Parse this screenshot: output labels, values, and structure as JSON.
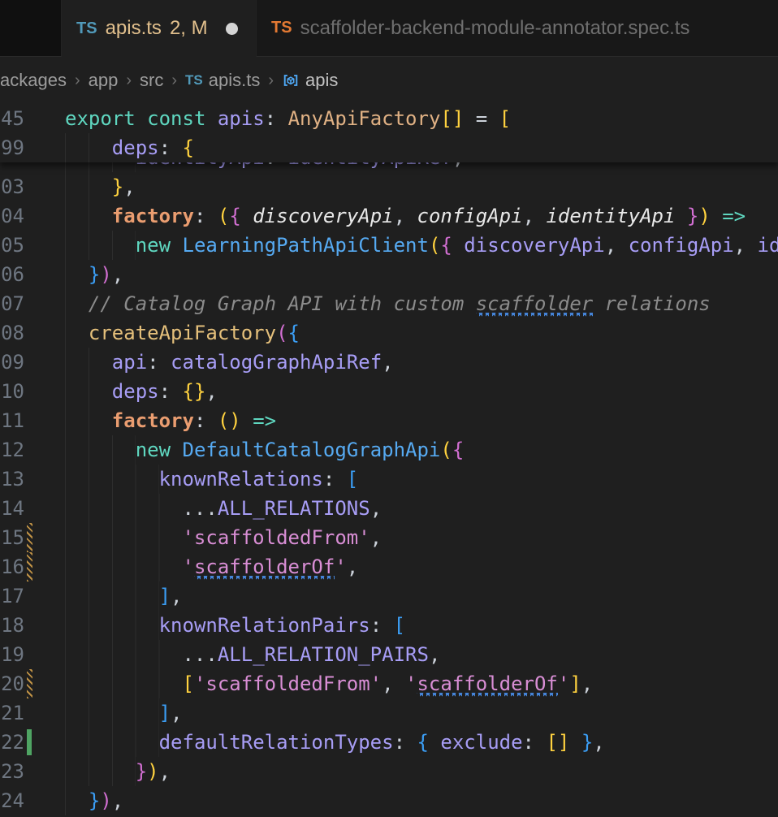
{
  "colors": {
    "editor_bg": "#1f1f1f",
    "tabstrip_bg": "#181818",
    "active_tab_bg": "#1f1f1f",
    "modified_gold": "#e2c08d",
    "ts_icon_blue": "#519aba",
    "ts_icon_orange": "#e37933",
    "inactive_tab_text": "#6f6f6f",
    "breadcrumb_text": "#9d9d9d",
    "line_number": "#6e7681",
    "squiggle_blue": "#4584d8",
    "gutter_modified": "#c09245",
    "gutter_added": "#4fa463",
    "keyword": "#5fd7c0",
    "var": "#a79df5",
    "prop": "#a79df5",
    "type": "#e0b184",
    "func": "#e5c07b",
    "member": "#ea9d70",
    "string": "#d98ed5",
    "class": "#56aaf2",
    "comment": "#8b8b8b",
    "param": "#e8e8e8",
    "punct": "#ccd2da",
    "b1": "#ffd23f",
    "b2": "#d26fd2",
    "b3": "#3b9ef5"
  },
  "tabs": [
    {
      "icon": "TS",
      "label": "apis.ts",
      "badge": "2, M",
      "modified_dot": true,
      "active": true
    },
    {
      "icon": "TS",
      "label": "scaffolder-backend-module-annotator.spec.ts",
      "badge": "",
      "modified_dot": false,
      "active": false
    }
  ],
  "breadcrumb": {
    "items": [
      "ackages",
      "app",
      "src",
      "apis.ts",
      "apis"
    ],
    "separator": "›",
    "file_icon": "TS"
  },
  "editor": {
    "sticky_lines": [
      {
        "num": "45",
        "ind": 0,
        "tokens": [
          {
            "t": "export",
            "c": "keyword"
          },
          {
            "t": " ",
            "c": "punct"
          },
          {
            "t": "const",
            "c": "keyword"
          },
          {
            "t": " ",
            "c": "punct"
          },
          {
            "t": "apis",
            "c": "var"
          },
          {
            "t": ": ",
            "c": "punct"
          },
          {
            "t": "AnyApiFactory",
            "c": "type"
          },
          {
            "t": "[]",
            "c": "b1"
          },
          {
            "t": " = ",
            "c": "punct"
          },
          {
            "t": "[",
            "c": "b1"
          }
        ]
      },
      {
        "num": "99",
        "ind": 4,
        "tokens": [
          {
            "t": "deps",
            "c": "prop"
          },
          {
            "t": ": ",
            "c": "punct"
          },
          {
            "t": "{",
            "c": "b1"
          }
        ]
      }
    ],
    "lines": [
      {
        "num": "",
        "ind": 6,
        "tokens": [
          {
            "t": "identityApi",
            "c": "prop"
          },
          {
            "t": ": ",
            "c": "punct"
          },
          {
            "t": "identityApiRef",
            "c": "var"
          },
          {
            "t": ",",
            "c": "punct"
          }
        ]
      },
      {
        "num": "03",
        "ind": 4,
        "tokens": [
          {
            "t": "}",
            "c": "b1"
          },
          {
            "t": ",",
            "c": "punct"
          }
        ]
      },
      {
        "num": "04",
        "ind": 4,
        "tokens": [
          {
            "t": "factory",
            "c": "member",
            "b": 1
          },
          {
            "t": ": ",
            "c": "punct"
          },
          {
            "t": "(",
            "c": "b1"
          },
          {
            "t": "{",
            "c": "b2"
          },
          {
            "t": " ",
            "c": "punct"
          },
          {
            "t": "discoveryApi",
            "c": "param",
            "i": 1
          },
          {
            "t": ", ",
            "c": "punct"
          },
          {
            "t": "configApi",
            "c": "param",
            "i": 1
          },
          {
            "t": ", ",
            "c": "punct"
          },
          {
            "t": "identityApi",
            "c": "param",
            "i": 1
          },
          {
            "t": " ",
            "c": "punct"
          },
          {
            "t": "}",
            "c": "b2"
          },
          {
            "t": ")",
            "c": "b1"
          },
          {
            "t": " ",
            "c": "punct"
          },
          {
            "t": "=>",
            "c": "keyword"
          }
        ]
      },
      {
        "num": "05",
        "ind": 6,
        "tokens": [
          {
            "t": "new",
            "c": "keyword"
          },
          {
            "t": " ",
            "c": "punct"
          },
          {
            "t": "LearningPathApiClient",
            "c": "class"
          },
          {
            "t": "(",
            "c": "b1"
          },
          {
            "t": "{",
            "c": "b2"
          },
          {
            "t": " ",
            "c": "punct"
          },
          {
            "t": "discoveryApi",
            "c": "var"
          },
          {
            "t": ", ",
            "c": "punct"
          },
          {
            "t": "configApi",
            "c": "var"
          },
          {
            "t": ", ",
            "c": "punct"
          },
          {
            "t": "id",
            "c": "var"
          }
        ]
      },
      {
        "num": "06",
        "ind": 2,
        "tokens": [
          {
            "t": "}",
            "c": "b3"
          },
          {
            "t": ")",
            "c": "b2"
          },
          {
            "t": ",",
            "c": "punct"
          }
        ]
      },
      {
        "num": "07",
        "ind": 2,
        "tokens": [
          {
            "t": "// Catalog Graph API with custom ",
            "c": "comment",
            "i": 1
          },
          {
            "t": "scaffolder",
            "c": "comment",
            "i": 1,
            "sq": 1
          },
          {
            "t": " relations",
            "c": "comment",
            "i": 1
          }
        ]
      },
      {
        "num": "08",
        "ind": 2,
        "tokens": [
          {
            "t": "createApiFactory",
            "c": "func"
          },
          {
            "t": "(",
            "c": "b2"
          },
          {
            "t": "{",
            "c": "b3"
          }
        ]
      },
      {
        "num": "09",
        "ind": 4,
        "tokens": [
          {
            "t": "api",
            "c": "prop"
          },
          {
            "t": ": ",
            "c": "punct"
          },
          {
            "t": "catalogGraphApiRef",
            "c": "var"
          },
          {
            "t": ",",
            "c": "punct"
          }
        ]
      },
      {
        "num": "10",
        "ind": 4,
        "tokens": [
          {
            "t": "deps",
            "c": "prop"
          },
          {
            "t": ": ",
            "c": "punct"
          },
          {
            "t": "{}",
            "c": "b1"
          },
          {
            "t": ",",
            "c": "punct"
          }
        ]
      },
      {
        "num": "11",
        "ind": 4,
        "tokens": [
          {
            "t": "factory",
            "c": "member",
            "b": 1
          },
          {
            "t": ": ",
            "c": "punct"
          },
          {
            "t": "()",
            "c": "b1"
          },
          {
            "t": " ",
            "c": "punct"
          },
          {
            "t": "=>",
            "c": "keyword"
          }
        ]
      },
      {
        "num": "12",
        "ind": 6,
        "tokens": [
          {
            "t": "new",
            "c": "keyword"
          },
          {
            "t": " ",
            "c": "punct"
          },
          {
            "t": "DefaultCatalogGraphApi",
            "c": "class"
          },
          {
            "t": "(",
            "c": "b1"
          },
          {
            "t": "{",
            "c": "b2"
          }
        ]
      },
      {
        "num": "13",
        "ind": 8,
        "tokens": [
          {
            "t": "knownRelations",
            "c": "prop"
          },
          {
            "t": ": ",
            "c": "punct"
          },
          {
            "t": "[",
            "c": "b3"
          }
        ]
      },
      {
        "num": "14",
        "ind": 10,
        "tokens": [
          {
            "t": "...",
            "c": "punct"
          },
          {
            "t": "ALL_RELATIONS",
            "c": "var"
          },
          {
            "t": ",",
            "c": "punct"
          }
        ]
      },
      {
        "num": "15",
        "ind": 10,
        "marker": "modified",
        "tokens": [
          {
            "t": "'scaffoldedFrom'",
            "c": "string"
          },
          {
            "t": ",",
            "c": "punct"
          }
        ]
      },
      {
        "num": "16",
        "ind": 10,
        "marker": "modified",
        "tokens": [
          {
            "t": "'",
            "c": "string"
          },
          {
            "t": "scaffolderOf",
            "c": "string",
            "sq": 1
          },
          {
            "t": "'",
            "c": "string"
          },
          {
            "t": ",",
            "c": "punct"
          }
        ]
      },
      {
        "num": "17",
        "ind": 8,
        "tokens": [
          {
            "t": "]",
            "c": "b3"
          },
          {
            "t": ",",
            "c": "punct"
          }
        ]
      },
      {
        "num": "18",
        "ind": 8,
        "tokens": [
          {
            "t": "knownRelationPairs",
            "c": "prop"
          },
          {
            "t": ": ",
            "c": "punct"
          },
          {
            "t": "[",
            "c": "b3"
          }
        ]
      },
      {
        "num": "19",
        "ind": 10,
        "tokens": [
          {
            "t": "...",
            "c": "punct"
          },
          {
            "t": "ALL_RELATION_PAIRS",
            "c": "var"
          },
          {
            "t": ",",
            "c": "punct"
          }
        ]
      },
      {
        "num": "20",
        "ind": 10,
        "marker": "modified",
        "tokens": [
          {
            "t": "[",
            "c": "b1"
          },
          {
            "t": "'scaffoldedFrom'",
            "c": "string"
          },
          {
            "t": ", ",
            "c": "punct"
          },
          {
            "t": "'",
            "c": "string"
          },
          {
            "t": "scaffolderOf",
            "c": "string",
            "sq": 1
          },
          {
            "t": "'",
            "c": "string"
          },
          {
            "t": "]",
            "c": "b1"
          },
          {
            "t": ",",
            "c": "punct"
          }
        ]
      },
      {
        "num": "21",
        "ind": 8,
        "tokens": [
          {
            "t": "]",
            "c": "b3"
          },
          {
            "t": ",",
            "c": "punct"
          }
        ]
      },
      {
        "num": "22",
        "ind": 8,
        "marker": "added",
        "tokens": [
          {
            "t": "defaultRelationTypes",
            "c": "prop"
          },
          {
            "t": ": ",
            "c": "punct"
          },
          {
            "t": "{",
            "c": "b3"
          },
          {
            "t": " ",
            "c": "punct"
          },
          {
            "t": "exclude",
            "c": "prop"
          },
          {
            "t": ": ",
            "c": "punct"
          },
          {
            "t": "[]",
            "c": "b1"
          },
          {
            "t": " ",
            "c": "punct"
          },
          {
            "t": "}",
            "c": "b3"
          },
          {
            "t": ",",
            "c": "punct"
          }
        ]
      },
      {
        "num": "23",
        "ind": 6,
        "tokens": [
          {
            "t": "}",
            "c": "b2"
          },
          {
            "t": ")",
            "c": "b1"
          },
          {
            "t": ",",
            "c": "punct"
          }
        ]
      },
      {
        "num": "24",
        "ind": 2,
        "tokens": [
          {
            "t": "}",
            "c": "b3"
          },
          {
            "t": ")",
            "c": "b2"
          },
          {
            "t": ",",
            "c": "punct"
          }
        ]
      }
    ]
  }
}
